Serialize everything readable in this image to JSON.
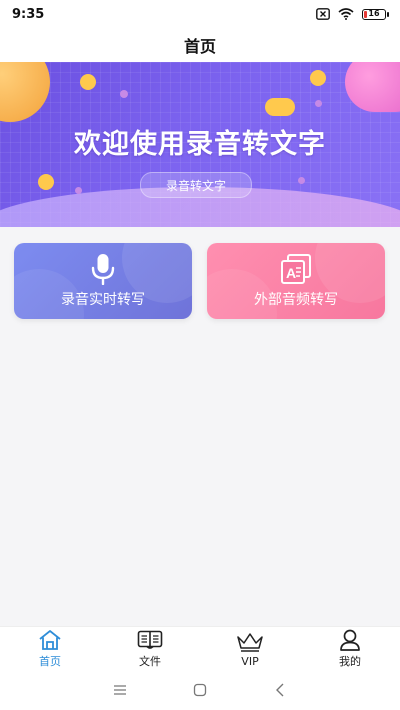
{
  "status": {
    "time": "9:35",
    "battery": "16",
    "icons": [
      "close-box-icon",
      "wifi-icon",
      "battery-icon"
    ]
  },
  "header": {
    "title": "首页"
  },
  "banner": {
    "headline": "欢迎使用录音转文字",
    "button_label": "录音转文字"
  },
  "actions": [
    {
      "label": "录音实时转写",
      "icon": "microphone-icon",
      "color": "#7580e6"
    },
    {
      "label": "外部音频转写",
      "icon": "audio-file-icon",
      "color": "#f97fa4"
    }
  ],
  "tabs": [
    {
      "label": "首页",
      "icon": "home-icon",
      "active": true
    },
    {
      "label": "文件",
      "icon": "book-icon",
      "active": false
    },
    {
      "label": "VIP",
      "icon": "crown-icon",
      "active": false
    },
    {
      "label": "我的",
      "icon": "user-icon",
      "active": false
    }
  ],
  "colors": {
    "accent": "#2e8dd8",
    "banner": "#7c63ef"
  }
}
